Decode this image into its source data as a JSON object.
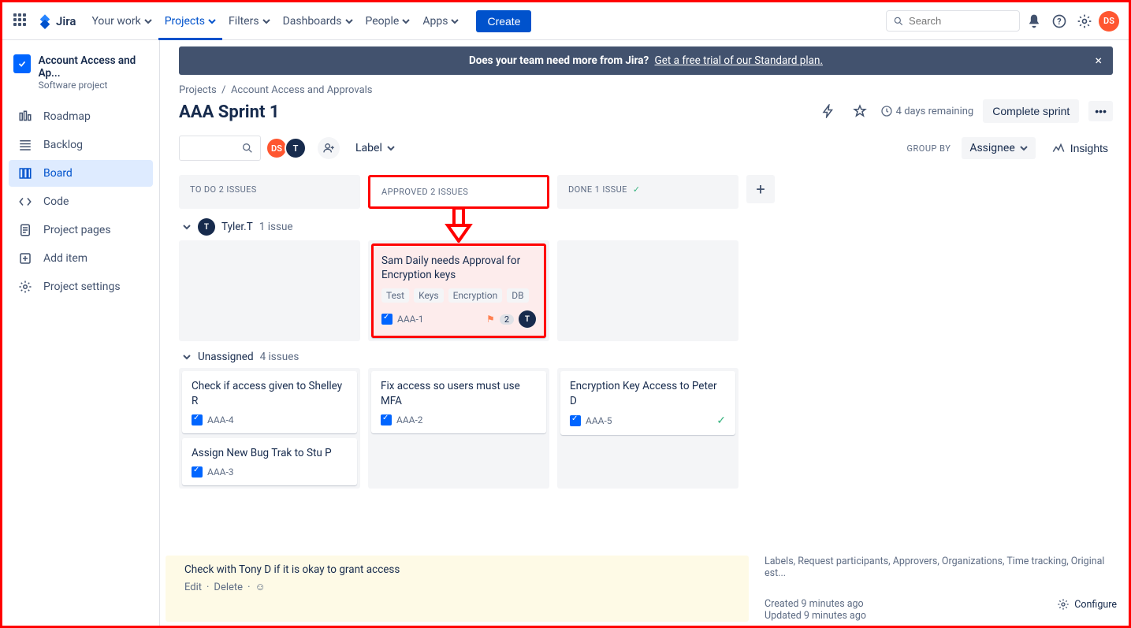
{
  "nav": {
    "product": "Jira",
    "items": [
      "Your work",
      "Projects",
      "Filters",
      "Dashboards",
      "People",
      "Apps"
    ],
    "active_index": 1,
    "create": "Create",
    "search_placeholder": "Search"
  },
  "user_avatar": "DS",
  "banner": {
    "text": "Does your team need more from Jira?",
    "link": "Get a free trial of our Standard plan."
  },
  "project": {
    "name": "Account Access and Ap...",
    "type": "Software project",
    "sidebar": [
      {
        "icon": "roadmap",
        "label": "Roadmap"
      },
      {
        "icon": "backlog",
        "label": "Backlog"
      },
      {
        "icon": "board",
        "label": "Board"
      },
      {
        "icon": "code",
        "label": "Code"
      },
      {
        "icon": "page",
        "label": "Project pages"
      },
      {
        "icon": "add",
        "label": "Add item"
      },
      {
        "icon": "settings",
        "label": "Project settings"
      }
    ],
    "active_side_index": 2
  },
  "breadcrumbs": [
    "Projects",
    "Account Access and Approvals"
  ],
  "sprint_title": "AAA Sprint 1",
  "days_remaining": "4 days remaining",
  "complete_btn": "Complete sprint",
  "filters": {
    "label": "Label",
    "avatars": [
      "DS",
      "T"
    ],
    "groupby_label": "GROUP BY",
    "groupby_value": "Assignee",
    "insights": "Insights"
  },
  "columns": [
    {
      "title": "TO DO 2 ISSUES"
    },
    {
      "title": "APPROVED 2 ISSUES",
      "highlight": true
    },
    {
      "title": "DONE 1 ISSUE",
      "done": true
    }
  ],
  "swimlanes": [
    {
      "name": "Tyler.T",
      "avatar": "T",
      "count": "1 issue",
      "cells": [
        [],
        [
          {
            "title": "Sam Daily needs Approval for Encryption keys",
            "labels": [
              "Test",
              "Keys",
              "Encryption",
              "DB"
            ],
            "key": "AAA-1",
            "flag": true,
            "badge": "2",
            "assignee": "T",
            "highlight": true
          }
        ],
        []
      ]
    },
    {
      "name": "Unassigned",
      "count": "4 issues",
      "cells": [
        [
          {
            "title": "Check if access given to Shelley R",
            "key": "AAA-4"
          },
          {
            "title": "Assign New Bug Trak to Stu P",
            "key": "AAA-3"
          }
        ],
        [
          {
            "title": "Fix access so users must use MFA",
            "key": "AAA-2"
          }
        ],
        [
          {
            "title": "Encryption Key Access to Peter D",
            "key": "AAA-5",
            "done": true
          }
        ]
      ]
    }
  ],
  "detail": {
    "comment": "Check with Tony D if it is okay to grant access",
    "edit": "Edit",
    "delete": "Delete",
    "fields_hint": "Labels, Request participants, Approvers, Organizations, Time tracking, Original est...",
    "created": "Created 9 minutes ago",
    "updated": "Updated 9 minutes ago",
    "configure": "Configure"
  }
}
